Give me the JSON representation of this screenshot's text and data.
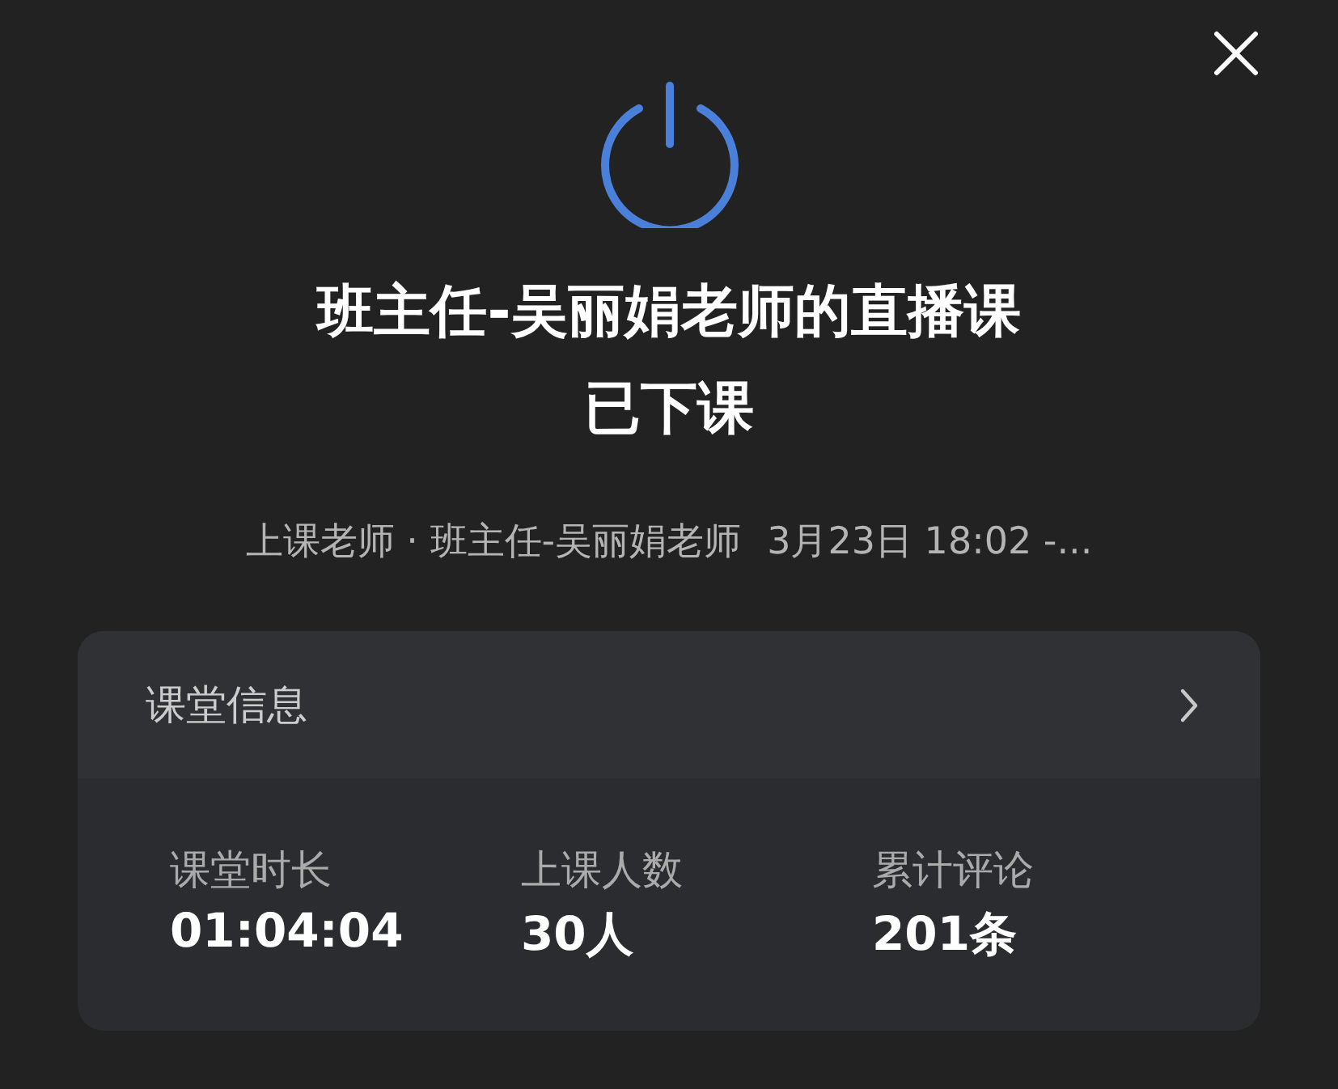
{
  "title": [
    "班主任-吴丽娟老师的直播课",
    "已下课"
  ],
  "subtitle": {
    "teacher": "上课老师 · 班主任-吴丽娟老师",
    "time": "3月23日 18:02 -..."
  },
  "card": {
    "title": "课堂信息",
    "stats": [
      {
        "label": "课堂时长",
        "value": "01:04:04"
      },
      {
        "label": "上课人数",
        "value": "30人"
      },
      {
        "label": "累计评论",
        "value": "201条"
      }
    ]
  }
}
